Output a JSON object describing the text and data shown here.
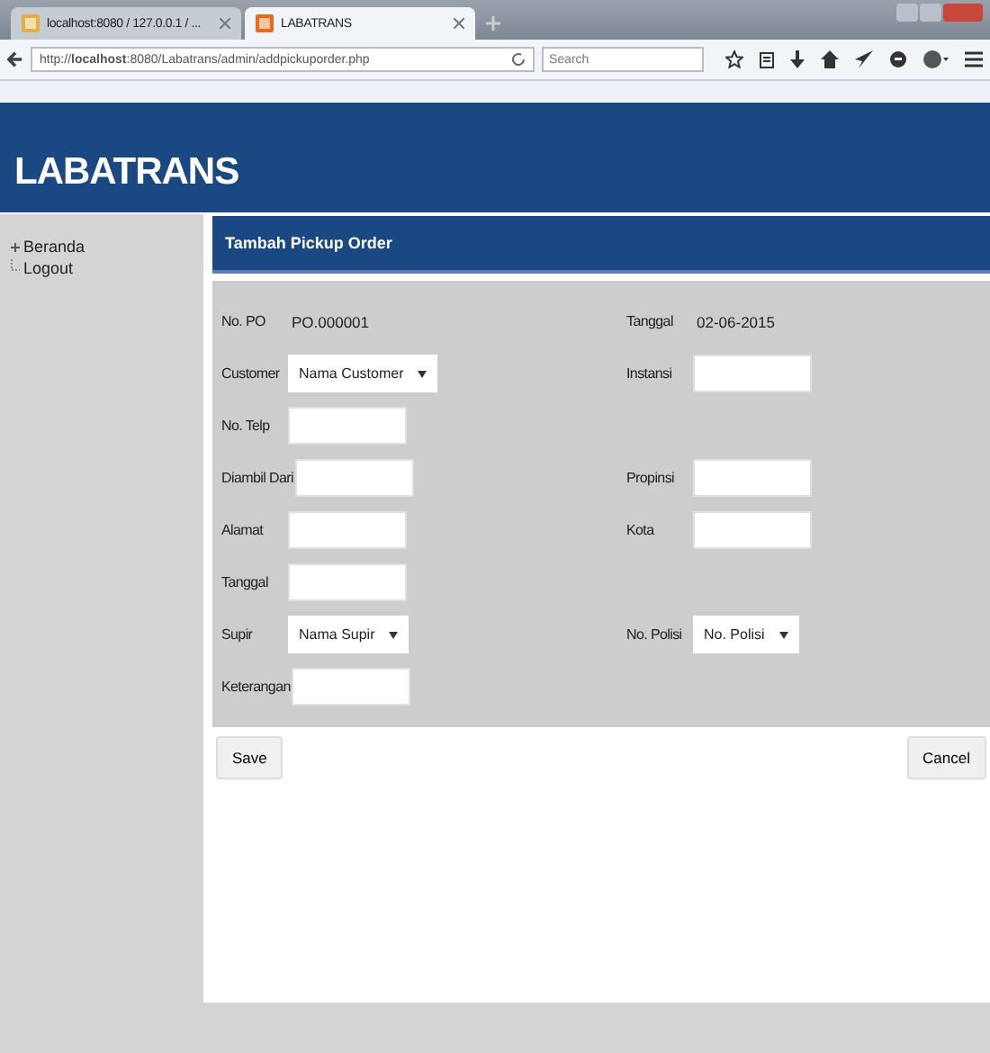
{
  "browser": {
    "tabs": [
      {
        "title": "localhost:8080 / 127.0.0.1 / ...",
        "selected": false
      },
      {
        "title": "LABATRANS",
        "selected": true
      }
    ],
    "url_prefix": "http://",
    "url_host": "localhost",
    "url_rest": ":8080/Labatrans/admin/addpickuporder.php",
    "search": {
      "placeholder": "Search"
    }
  },
  "header": {
    "title": "LABATRANS"
  },
  "sidebar": {
    "items": [
      {
        "label": "Beranda"
      },
      {
        "label": "Logout"
      }
    ]
  },
  "panel": {
    "title": "Tambah Pickup Order",
    "rows": [
      {
        "left": {
          "kind": "text",
          "label": "No. PO",
          "value": "PO.000001"
        },
        "right": {
          "kind": "text",
          "label": "Tanggal",
          "value": "02-06-2015"
        }
      },
      {
        "left": {
          "kind": "select",
          "label": "Customer",
          "value": "Nama Customer"
        },
        "right": {
          "kind": "input",
          "label": "Instansi"
        }
      },
      {
        "left": {
          "kind": "input",
          "label": "No. Telp"
        }
      },
      {
        "left": {
          "kind": "input",
          "label": "Diambil Dari"
        },
        "right": {
          "kind": "input",
          "label": "Propinsi"
        }
      },
      {
        "left": {
          "kind": "input",
          "label": "Alamat"
        },
        "right": {
          "kind": "input",
          "label": "Kota"
        }
      },
      {
        "left": {
          "kind": "input",
          "label": "Tanggal"
        }
      },
      {
        "left": {
          "kind": "select",
          "label": "Supir",
          "value": "Nama Supir"
        },
        "right": {
          "kind": "select",
          "label": "No. Polisi",
          "value": "No. Polisi"
        }
      },
      {
        "left": {
          "kind": "input",
          "label": "Keterangan"
        }
      }
    ],
    "buttons": [
      "Save",
      "Cancel"
    ]
  }
}
